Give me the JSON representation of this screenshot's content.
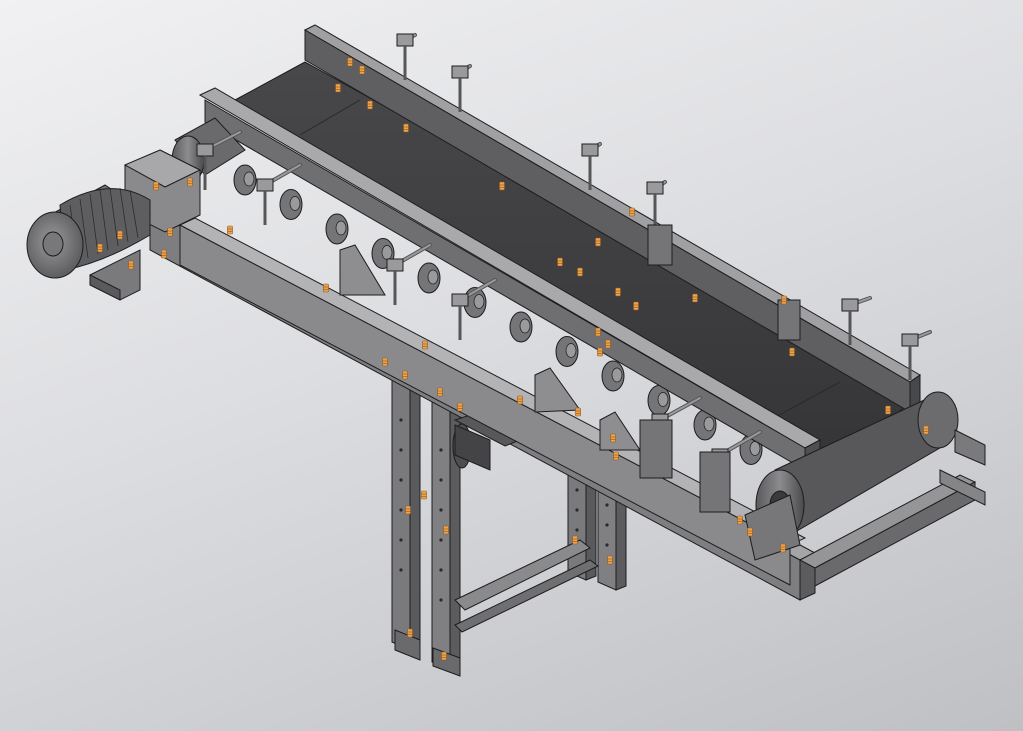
{
  "scene": {
    "subject": "belt-conveyor-assembly",
    "render_style": "shaded-3d-cad-with-edges",
    "colors": {
      "background_top": "#f1f1f3",
      "background_bottom": "#bfc0c4",
      "belt": "#3f3f42",
      "belt_edge": "#2e2e30",
      "steel_light": "#9a9a9c",
      "steel_mid": "#757577",
      "steel_dark": "#565658",
      "bolt": "#f0a24a",
      "outline": "#1d1d1f"
    },
    "components": [
      "drive-motor",
      "gear-reducer",
      "drive-drum",
      "tail-drum",
      "conveyor-belt",
      "side-skirt",
      "carrying-rollers",
      "frame-beams",
      "support-legs",
      "adjustment-brackets",
      "bolts"
    ]
  }
}
